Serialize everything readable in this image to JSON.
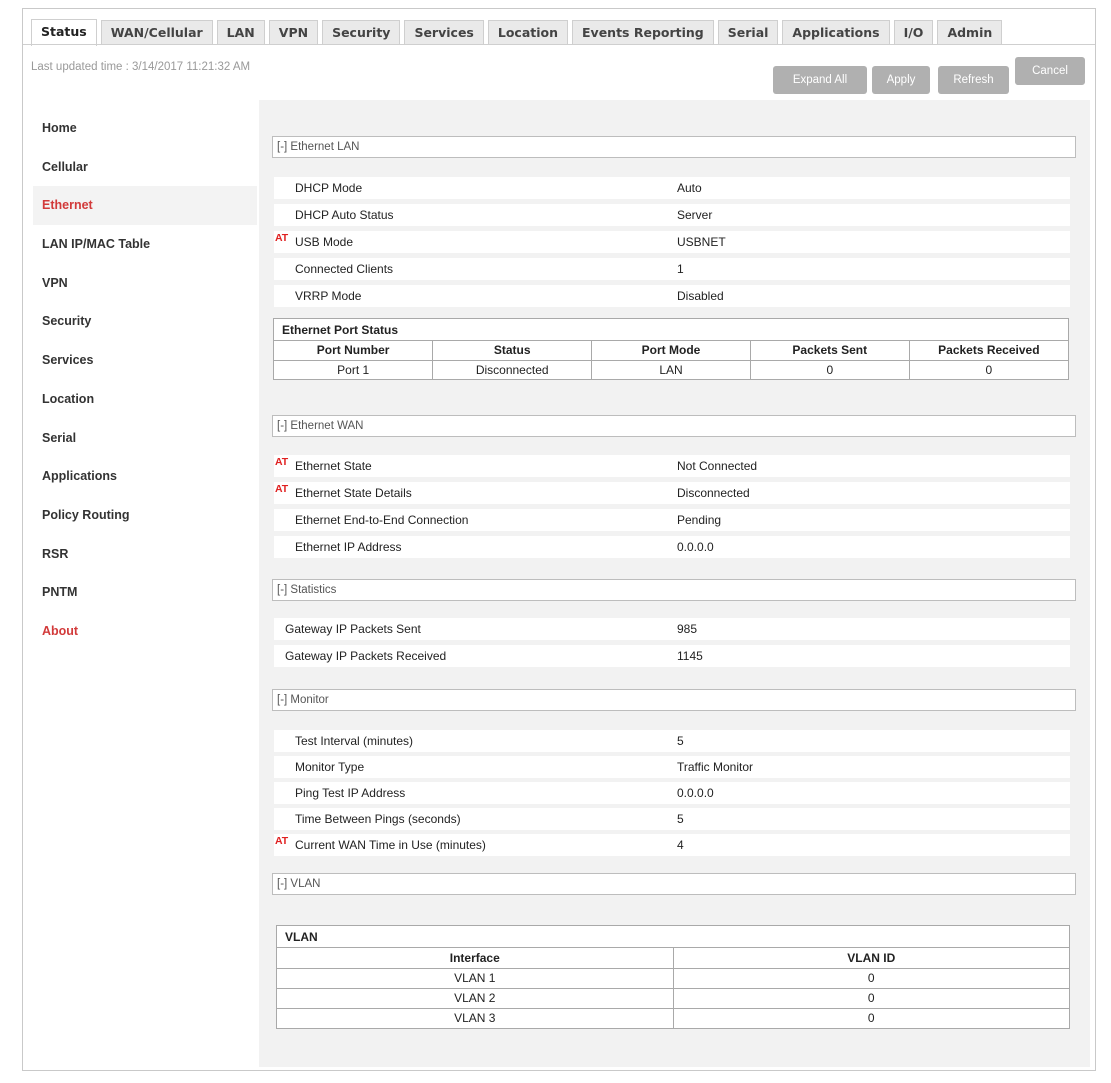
{
  "tabs": [
    "Status",
    "WAN/Cellular",
    "LAN",
    "VPN",
    "Security",
    "Services",
    "Location",
    "Events Reporting",
    "Serial",
    "Applications",
    "I/O",
    "Admin"
  ],
  "last_updated": "Last updated time : 3/14/2017 11:21:32 AM",
  "buttons": {
    "expand_all": "Expand All",
    "apply": "Apply",
    "refresh": "Refresh",
    "cancel": "Cancel"
  },
  "sidebar": [
    "Home",
    "Cellular",
    "Ethernet",
    "LAN IP/MAC Table",
    "VPN",
    "Security",
    "Services",
    "Location",
    "Serial",
    "Applications",
    "Policy Routing",
    "RSR",
    "PNTM",
    "About"
  ],
  "sidebar_active": "Ethernet",
  "at_marker": "AT",
  "ethernet_lan": {
    "header": "[-] Ethernet LAN",
    "rows": [
      {
        "label": "DHCP Mode",
        "value": "Auto",
        "at": false
      },
      {
        "label": "DHCP Auto Status",
        "value": "Server",
        "at": false
      },
      {
        "label": "USB Mode",
        "value": "USBNET",
        "at": true
      },
      {
        "label": "Connected Clients",
        "value": "1",
        "at": false
      },
      {
        "label": "VRRP Mode",
        "value": "Disabled",
        "at": false
      }
    ],
    "port_table": {
      "caption": "Ethernet Port Status",
      "columns": [
        "Port Number",
        "Status",
        "Port Mode",
        "Packets Sent",
        "Packets Received"
      ],
      "rows": [
        [
          "Port 1",
          "Disconnected",
          "LAN",
          "0",
          "0"
        ]
      ]
    }
  },
  "ethernet_wan": {
    "header": "[-] Ethernet WAN",
    "rows": [
      {
        "label": "Ethernet State",
        "value": "Not Connected",
        "at": true
      },
      {
        "label": "Ethernet State Details",
        "value": "Disconnected",
        "at": true
      },
      {
        "label": "Ethernet End-to-End Connection",
        "value": "Pending",
        "at": false
      },
      {
        "label": "Ethernet IP Address",
        "value": "0.0.0.0",
        "at": false
      }
    ]
  },
  "statistics": {
    "header": "[-] Statistics",
    "rows": [
      {
        "label": "Gateway IP Packets Sent",
        "value": "985"
      },
      {
        "label": "Gateway IP Packets Received",
        "value": "1145"
      }
    ]
  },
  "monitor": {
    "header": "[-] Monitor",
    "rows": [
      {
        "label": "Test Interval (minutes)",
        "value": "5",
        "at": false
      },
      {
        "label": "Monitor Type",
        "value": "Traffic Monitor",
        "at": false
      },
      {
        "label": "Ping Test IP Address",
        "value": "0.0.0.0",
        "at": false
      },
      {
        "label": "Time Between Pings (seconds)",
        "value": "5",
        "at": false
      },
      {
        "label": "Current WAN Time in Use (minutes)",
        "value": "4",
        "at": true
      }
    ]
  },
  "vlan": {
    "header": "[-] VLAN",
    "table": {
      "caption": "VLAN",
      "columns": [
        "Interface",
        "VLAN ID"
      ],
      "rows": [
        [
          "VLAN 1",
          "0"
        ],
        [
          "VLAN 2",
          "0"
        ],
        [
          "VLAN 3",
          "0"
        ]
      ]
    }
  },
  "colors": {
    "accent_red": "#d23a3a",
    "at_red": "#e02020",
    "button_gray": "#b0b0b0",
    "panel_bg": "#f2f2f2"
  }
}
